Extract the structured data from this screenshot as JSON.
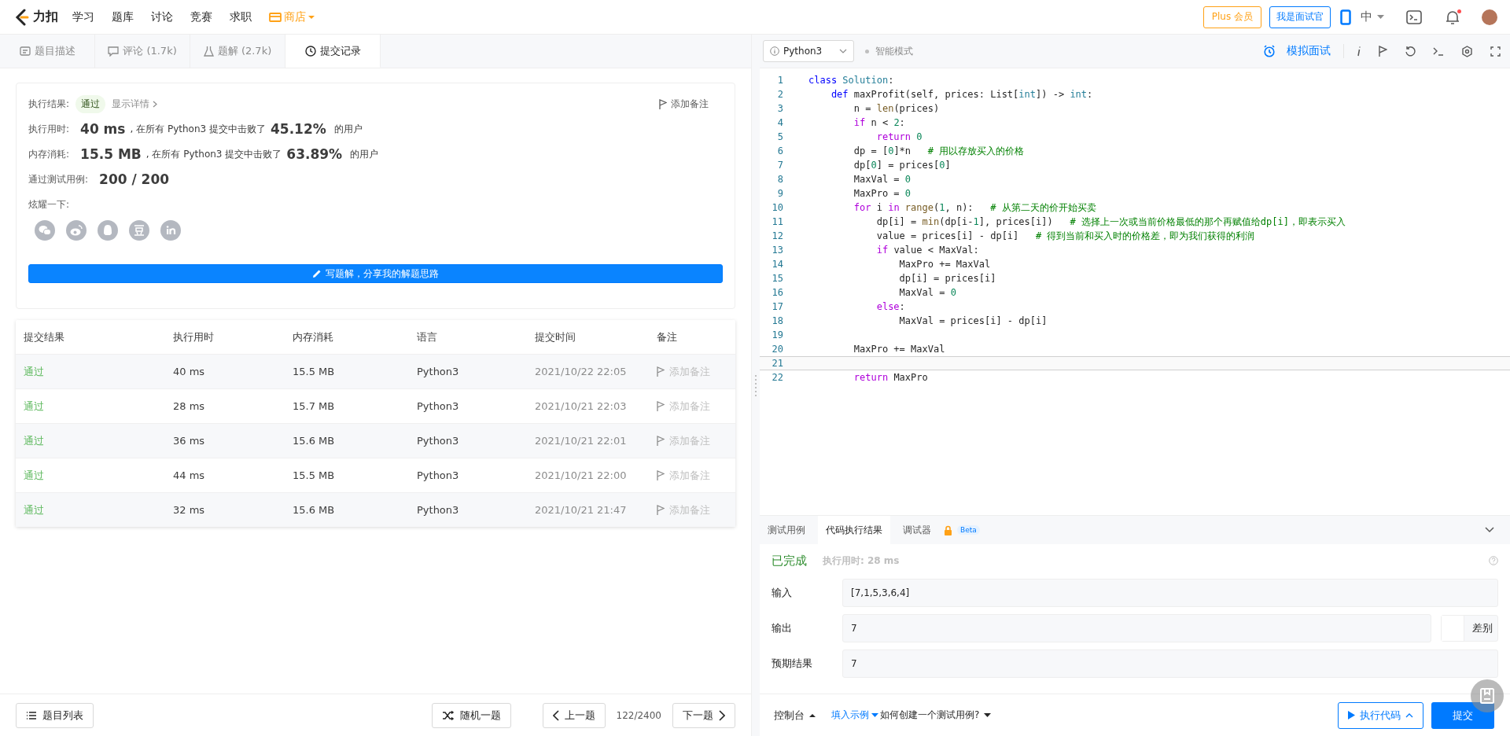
{
  "nav": {
    "logo": "力扣",
    "items": [
      "学习",
      "题库",
      "讨论",
      "竞赛",
      "求职"
    ],
    "store": "商店",
    "plus": "Plus 会员",
    "interviewer": "我是面试官",
    "lang": "中",
    "notification": true
  },
  "tabs": [
    {
      "label": "题目描述",
      "selected": false
    },
    {
      "label": "评论 (1.7k)",
      "selected": false
    },
    {
      "label": "题解 (2.7k)",
      "selected": false
    },
    {
      "label": "提交记录",
      "selected": true
    }
  ],
  "result": {
    "label": "执行结果:",
    "status": "通过",
    "details": "显示详情",
    "note": "添加备注",
    "stats": [
      {
        "label": "执行用时:",
        "value": "40 ms",
        "text": ", 在所有 Python3 提交中击败了",
        "pct": "45.12%",
        "suffix": "的用户"
      },
      {
        "label": "内存消耗:",
        "value": "15.5 MB",
        "text": ", 在所有 Python3 提交中击败了",
        "pct": "63.89%",
        "suffix": "的用户"
      }
    ],
    "tests_label": "通过测试用例:",
    "tests": "200 / 200",
    "share_label": "炫耀一下:",
    "write_button": "写题解，分享我的解题思路"
  },
  "table": {
    "columns": [
      "提交结果",
      "执行用时",
      "内存消耗",
      "语言",
      "提交时间",
      "备注"
    ],
    "rows": [
      {
        "result": "通过",
        "time": "40 ms",
        "memory": "15.5 MB",
        "language": "Python3",
        "submitted": "2021/10/22 22:05",
        "note": "添加备注"
      },
      {
        "result": "通过",
        "time": "28 ms",
        "memory": "15.7 MB",
        "language": "Python3",
        "submitted": "2021/10/21 22:03",
        "note": "添加备注"
      },
      {
        "result": "通过",
        "time": "36 ms",
        "memory": "15.6 MB",
        "language": "Python3",
        "submitted": "2021/10/21 22:01",
        "note": "添加备注"
      },
      {
        "result": "通过",
        "time": "44 ms",
        "memory": "15.5 MB",
        "language": "Python3",
        "submitted": "2021/10/21 22:00",
        "note": "添加备注"
      },
      {
        "result": "通过",
        "time": "32 ms",
        "memory": "15.6 MB",
        "language": "Python3",
        "submitted": "2021/10/21 21:47",
        "note": "添加备注"
      }
    ]
  },
  "editor": {
    "language": "Python3",
    "mode": "智能模式",
    "mock": "模拟面试",
    "lines": [
      {
        "no": "1",
        "current": false,
        "segs": [
          {
            "kind": "kw",
            "t": "class"
          },
          {
            "kind": "ty",
            "t": " Solution"
          },
          {
            "kind": "p",
            "t": ":"
          }
        ]
      },
      {
        "no": "2",
        "current": false,
        "segs": [
          {
            "kind": "kw",
            "t": "    def"
          },
          {
            "kind": "p",
            "t": " maxProfit(self, prices: List["
          },
          {
            "kind": "ty",
            "t": "int"
          },
          {
            "kind": "p",
            "t": "]) -> "
          },
          {
            "kind": "ty",
            "t": "int"
          },
          {
            "kind": "p",
            "t": ":"
          }
        ]
      },
      {
        "no": "3",
        "current": false,
        "segs": [
          {
            "kind": "p",
            "t": "        n = "
          },
          {
            "kind": "bi",
            "t": "len"
          },
          {
            "kind": "p",
            "t": "(prices)"
          }
        ]
      },
      {
        "no": "4",
        "current": false,
        "segs": [
          {
            "kind": "ctl",
            "t": "        if"
          },
          {
            "kind": "p",
            "t": " n < "
          },
          {
            "kind": "num",
            "t": "2"
          },
          {
            "kind": "p",
            "t": ":"
          }
        ]
      },
      {
        "no": "5",
        "current": false,
        "segs": [
          {
            "kind": "ctl",
            "t": "            return"
          },
          {
            "kind": "num",
            "t": " 0"
          }
        ]
      },
      {
        "no": "6",
        "current": false,
        "segs": [
          {
            "kind": "p",
            "t": "        dp = ["
          },
          {
            "kind": "num",
            "t": "0"
          },
          {
            "kind": "p",
            "t": "]*n   "
          },
          {
            "kind": "cm",
            "t": "# 用以存放买入的价格"
          }
        ]
      },
      {
        "no": "7",
        "current": false,
        "segs": [
          {
            "kind": "p",
            "t": "        dp["
          },
          {
            "kind": "num",
            "t": "0"
          },
          {
            "kind": "p",
            "t": "] = prices["
          },
          {
            "kind": "num",
            "t": "0"
          },
          {
            "kind": "p",
            "t": "]"
          }
        ]
      },
      {
        "no": "8",
        "current": false,
        "segs": [
          {
            "kind": "p",
            "t": "        MaxVal = "
          },
          {
            "kind": "num",
            "t": "0"
          }
        ]
      },
      {
        "no": "9",
        "current": false,
        "segs": [
          {
            "kind": "p",
            "t": "        MaxPro = "
          },
          {
            "kind": "num",
            "t": "0"
          }
        ]
      },
      {
        "no": "10",
        "current": false,
        "segs": [
          {
            "kind": "ctl",
            "t": "        for"
          },
          {
            "kind": "p",
            "t": " i "
          },
          {
            "kind": "ctl",
            "t": "in"
          },
          {
            "kind": "bi",
            "t": " range"
          },
          {
            "kind": "p",
            "t": "("
          },
          {
            "kind": "num",
            "t": "1"
          },
          {
            "kind": "p",
            "t": ", n):   "
          },
          {
            "kind": "cm",
            "t": "# 从第二天的价开始买卖"
          }
        ]
      },
      {
        "no": "11",
        "current": false,
        "segs": [
          {
            "kind": "p",
            "t": "            dp[i] = "
          },
          {
            "kind": "bi",
            "t": "min"
          },
          {
            "kind": "p",
            "t": "(dp[i-"
          },
          {
            "kind": "num",
            "t": "1"
          },
          {
            "kind": "p",
            "t": "], prices[i])   "
          },
          {
            "kind": "cm",
            "t": "# 选择上一次或当前价格最低的那个再赋值给dp[i]，即表示买入"
          }
        ]
      },
      {
        "no": "12",
        "current": false,
        "segs": [
          {
            "kind": "p",
            "t": "            value = prices[i] - dp[i]   "
          },
          {
            "kind": "cm",
            "t": "# 得到当前和买入时的价格差，即为我们获得的利润"
          }
        ]
      },
      {
        "no": "13",
        "current": false,
        "segs": [
          {
            "kind": "ctl",
            "t": "            if"
          },
          {
            "kind": "p",
            "t": " value < MaxVal:"
          }
        ]
      },
      {
        "no": "14",
        "current": false,
        "segs": [
          {
            "kind": "p",
            "t": "                MaxPro += MaxVal"
          }
        ]
      },
      {
        "no": "15",
        "current": false,
        "segs": [
          {
            "kind": "p",
            "t": "                dp[i] = prices[i]"
          }
        ]
      },
      {
        "no": "16",
        "current": false,
        "segs": [
          {
            "kind": "p",
            "t": "                MaxVal = "
          },
          {
            "kind": "num",
            "t": "0"
          }
        ]
      },
      {
        "no": "17",
        "current": false,
        "segs": [
          {
            "kind": "ctl",
            "t": "            else"
          },
          {
            "kind": "p",
            "t": ":"
          }
        ]
      },
      {
        "no": "18",
        "current": false,
        "segs": [
          {
            "kind": "p",
            "t": "                MaxVal = prices[i] - dp[i]"
          }
        ]
      },
      {
        "no": "19",
        "current": false
      },
      {
        "no": "20",
        "current": false,
        "segs": [
          {
            "kind": "p",
            "t": "        MaxPro += MaxVal"
          }
        ]
      },
      {
        "no": "21",
        "current": true
      },
      {
        "no": "22",
        "current": false,
        "segs": [
          {
            "kind": "ctl",
            "t": "        return"
          },
          {
            "kind": "p",
            "t": " MaxPro"
          }
        ]
      }
    ]
  },
  "console": {
    "tabs": [
      {
        "label": "测试用例",
        "selected": false
      },
      {
        "label": "代码执行结果",
        "selected": true
      },
      {
        "label": "调试器",
        "selected": false,
        "locked": true,
        "badge": "Beta"
      }
    ],
    "status": "已完成",
    "runtime": "执行用时: 28 ms",
    "fields": [
      {
        "label": "输入",
        "value": "[7,1,5,3,6,4]"
      },
      {
        "label": "输出",
        "value": "7",
        "diff": "差别"
      },
      {
        "label": "预期结果",
        "value": "7"
      }
    ]
  },
  "footer": {
    "list": "题目列表",
    "random": "随机一题",
    "prev": "上一题",
    "page": "122/2400",
    "next": "下一题",
    "console": "控制台",
    "example": "填入示例",
    "howto": "如何创建一个测试用例?",
    "run": "执行代码",
    "submit": "提交"
  }
}
